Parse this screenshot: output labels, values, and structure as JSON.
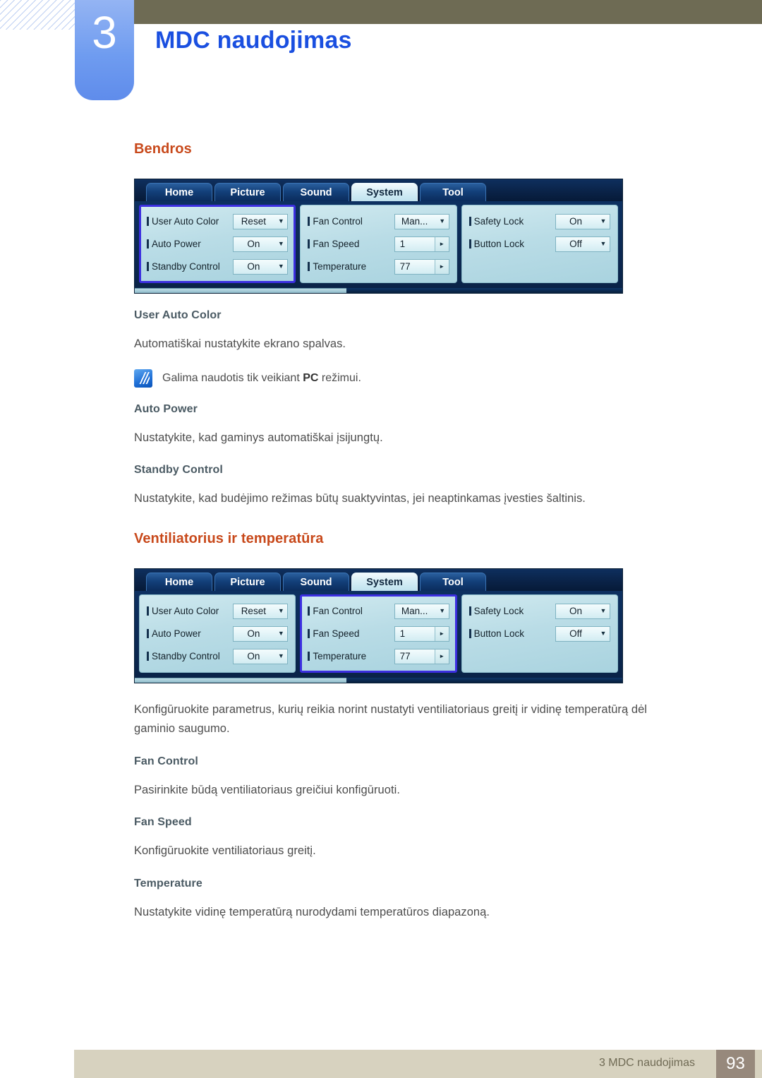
{
  "header": {
    "chapter_number": "3",
    "chapter_title": "MDC naudojimas"
  },
  "sections": {
    "general": {
      "heading": "Bendros",
      "items": [
        {
          "title": "User Auto Color",
          "body": "Automatiškai nustatykite ekrano spalvas.",
          "note_prefix": "Galima naudotis tik veikiant ",
          "note_bold": "PC",
          "note_suffix": " režimui."
        },
        {
          "title": "Auto Power",
          "body": "Nustatykite, kad gaminys automatiškai įsijungtų."
        },
        {
          "title": "Standby Control",
          "body": "Nustatykite, kad budėjimo režimas būtų suaktyvintas, jei neaptinkamas įvesties šaltinis."
        }
      ]
    },
    "fan": {
      "heading": "Ventiliatorius ir temperatūra",
      "intro": "Konfigūruokite parametrus, kurių reikia norint nustatyti ventiliatoriaus greitį ir vidinę temperatūrą dėl gaminio saugumo.",
      "items": [
        {
          "title": "Fan Control",
          "body": "Pasirinkite būdą ventiliatoriaus greičiui konfigūruoti."
        },
        {
          "title": "Fan Speed",
          "body": "Konfigūruokite ventiliatoriaus greitį."
        },
        {
          "title": "Temperature",
          "body": "Nustatykite vidinę temperatūrą nurodydami temperatūros diapazoną."
        }
      ]
    }
  },
  "mdc_app": {
    "tabs": [
      {
        "label": "Home",
        "active": false
      },
      {
        "label": "Picture",
        "active": false
      },
      {
        "label": "Sound",
        "active": false
      },
      {
        "label": "System",
        "active": true
      },
      {
        "label": "Tool",
        "active": false
      }
    ],
    "panels": {
      "general": [
        {
          "label": "User Auto Color",
          "value": "Reset",
          "control": "dropdown"
        },
        {
          "label": "Auto Power",
          "value": "On",
          "control": "dropdown"
        },
        {
          "label": "Standby Control",
          "value": "On",
          "control": "dropdown"
        }
      ],
      "fan": [
        {
          "label": "Fan Control",
          "value": "Man...",
          "control": "dropdown"
        },
        {
          "label": "Fan Speed",
          "value": "1",
          "control": "spinner"
        },
        {
          "label": "Temperature",
          "value": "77",
          "control": "spinner"
        }
      ],
      "lock": [
        {
          "label": "Safety Lock",
          "value": "On",
          "control": "dropdown"
        },
        {
          "label": "Button Lock",
          "value": "Off",
          "control": "dropdown"
        }
      ]
    },
    "icons": {
      "dropdown_caret": "▼",
      "spinner_caret": "►"
    },
    "highlight_color": "#3c2fe0"
  },
  "footer": {
    "text": "3 MDC naudojimas",
    "page_number": "93"
  }
}
